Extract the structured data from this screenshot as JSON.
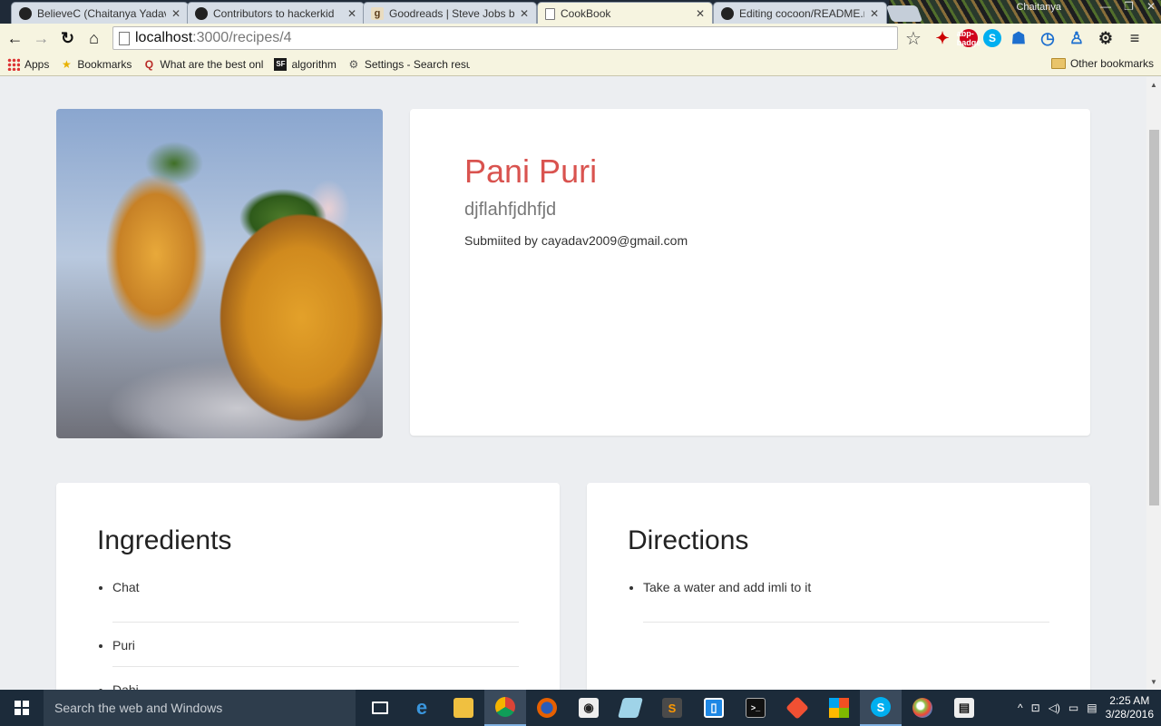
{
  "browser": {
    "tabs": [
      {
        "title": "BelieveC (Chaitanya Yadav",
        "icon": "github-icon",
        "active": false
      },
      {
        "title": "Contributors to hackerkid",
        "icon": "github-icon",
        "active": false
      },
      {
        "title": "Goodreads | Steve Jobs b",
        "icon": "goodreads-icon",
        "active": false
      },
      {
        "title": "CookBook",
        "icon": "page-icon",
        "active": true
      },
      {
        "title": "Editing cocoon/README.m",
        "icon": "github-icon",
        "active": false
      }
    ],
    "profile_name": "Chaitanya",
    "close_glyph": "✕",
    "url_host": "localhost",
    "url_path": ":3000/recipes/4",
    "bookmarks": [
      {
        "label": "Apps",
        "icon": "apps-icon"
      },
      {
        "label": "Bookmarks",
        "icon": "star-icon"
      },
      {
        "label": "What are the best onl",
        "icon": "quora-icon"
      },
      {
        "label": "algorithm",
        "icon": "sf-icon"
      },
      {
        "label": "Settings - Search resu",
        "icon": "gear-icon"
      }
    ],
    "other_bookmarks": "Other bookmarks",
    "extensions": [
      "abp-badge"
    ]
  },
  "recipe": {
    "title": "Pani Puri",
    "description": "djflahfjdhfjd",
    "submitted_by": "Submiited by cayadav2009@gmail.com",
    "title_color": "#d9534f"
  },
  "ingredients": {
    "heading": "Ingredients",
    "items": [
      "Chat",
      "Puri",
      "Dahi"
    ]
  },
  "directions": {
    "heading": "Directions",
    "items": [
      "Take a water and add imli to it"
    ]
  },
  "taskbar": {
    "search_placeholder": "Search the web and Windows",
    "time": "2:25 AM",
    "date": "3/28/2016"
  }
}
